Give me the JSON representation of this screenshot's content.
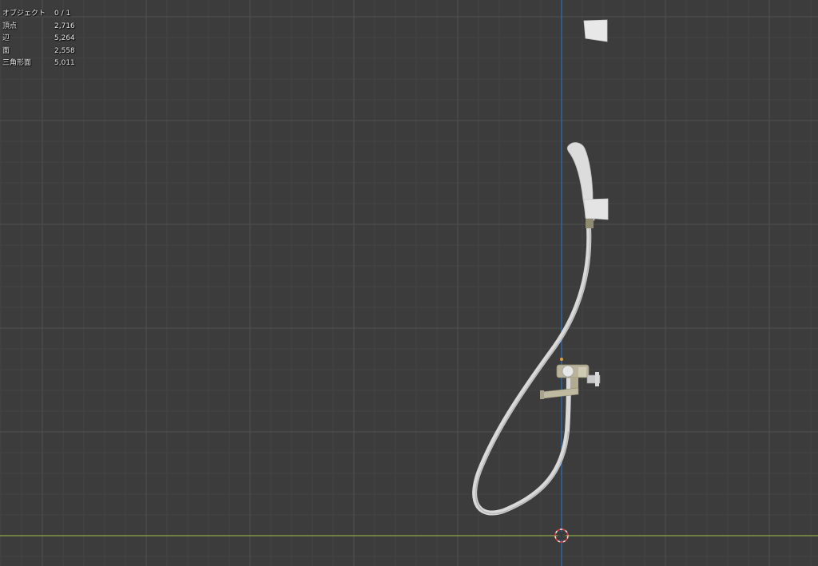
{
  "stats": [
    {
      "label": "オブジェクト",
      "value": "0 / 1"
    },
    {
      "label": "頂点",
      "value": "2,716"
    },
    {
      "label": "辺",
      "value": "5,264"
    },
    {
      "label": "面",
      "value": "2,558"
    },
    {
      "label": "三角形面",
      "value": "5,011"
    }
  ],
  "colors": {
    "background": "#3c3c3c",
    "grid_minor": "#444444",
    "grid_major": "#555555",
    "axis_z": "#2d6fb7",
    "axis_y": "#8ca64a",
    "object": "#d6d6d6",
    "cursor_red": "#e03c3c"
  }
}
